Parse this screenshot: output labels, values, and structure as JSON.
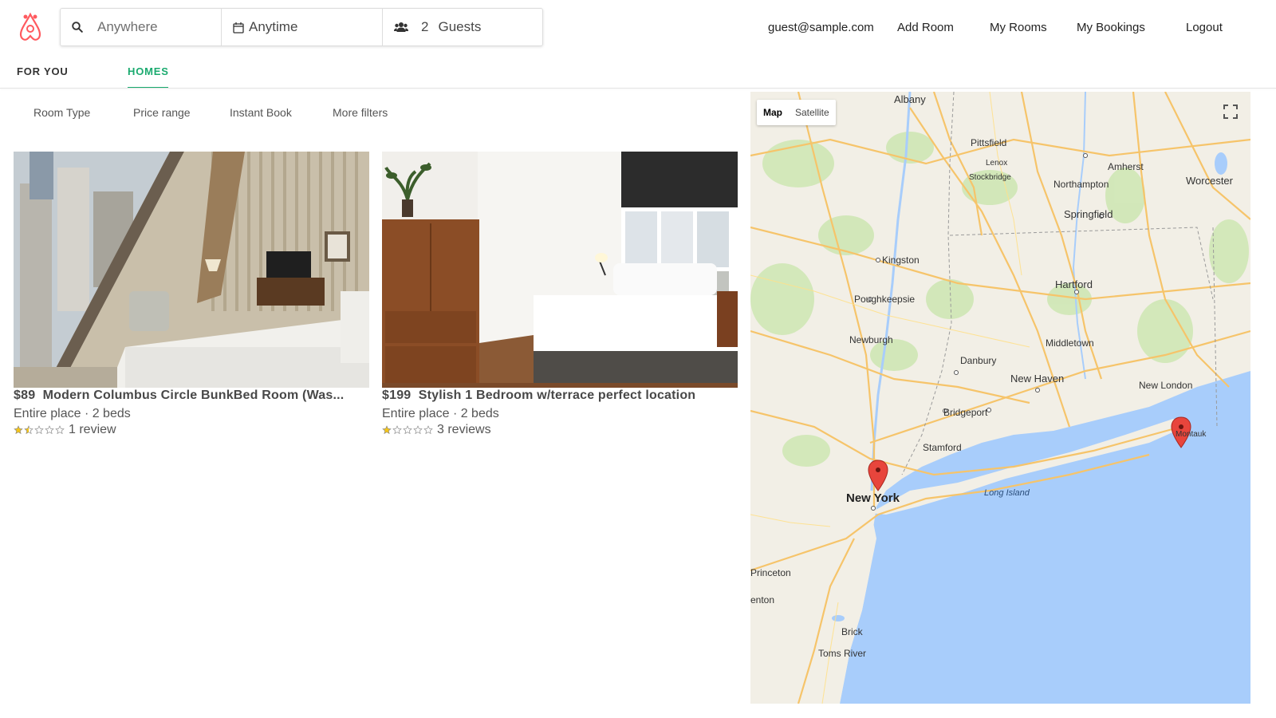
{
  "header": {
    "search": {
      "location_placeholder": "Anywhere",
      "date_label": "Anytime",
      "guests_count": "2",
      "guests_label": "Guests"
    },
    "nav": {
      "email": "guest@sample.com",
      "add_room": "Add Room",
      "my_rooms": "My Rooms",
      "my_bookings": "My Bookings",
      "logout": "Logout"
    }
  },
  "tabs": [
    {
      "label": "FOR YOU",
      "active": false
    },
    {
      "label": "HOMES",
      "active": true
    }
  ],
  "filters": [
    "Room Type",
    "Price range",
    "Instant Book",
    "More filters"
  ],
  "listings": [
    {
      "price": "$89",
      "title": "Modern Columbus Circle BunkBed Room (Was...",
      "details": "Entire place · 2 beds",
      "rating": 1.5,
      "reviews": "1 review"
    },
    {
      "price": "$199",
      "title": "Stylish 1 Bedroom w/terrace perfect location",
      "details": "Entire place · 2 beds",
      "rating": 1,
      "reviews": "3 reviews"
    }
  ],
  "map": {
    "mode_map": "Map",
    "mode_satellite": "Satellite",
    "places": [
      "Albany",
      "Pittsfield",
      "Lenox",
      "Stockbridge",
      "Amherst",
      "Northampton",
      "Worcester",
      "Springfield",
      "Kingston",
      "Hartford",
      "Poughkeepsie",
      "Newburgh",
      "Middletown",
      "Danbury",
      "New Haven",
      "New London",
      "Bridgeport",
      "Stamford",
      "New York",
      "Long Island",
      "Montauk",
      "Princeton",
      "enton",
      "Brick",
      "Toms River"
    ],
    "colors": {
      "water": "#a8cdfb",
      "land": "#f2efe6",
      "green": "#cfe7b5",
      "road": "#f6c46a",
      "marker": "#e8453c"
    }
  },
  "colors": {
    "accent": "#1aaa6f",
    "brand": "#ff5a5f",
    "star": "#f5c518"
  }
}
